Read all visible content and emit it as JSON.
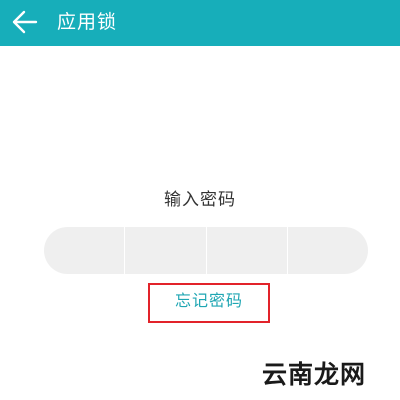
{
  "app_bar": {
    "back_icon": "back-arrow-icon",
    "title": "应用锁",
    "color": "#17aeba"
  },
  "lock_screen": {
    "prompt": "输入密码",
    "pin_slots": 4,
    "forgot_label": "忘记密码",
    "highlight_color": "#e2232a"
  },
  "watermark": {
    "text": "云南龙网"
  }
}
